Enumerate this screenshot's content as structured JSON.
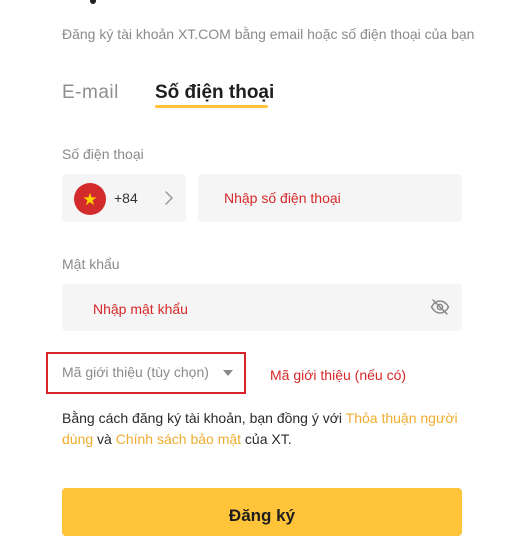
{
  "subtitle": "Đăng ký tài khoản XT.COM bằng email hoặc số điện thoại của bạn",
  "tabs": {
    "email": "E-mail",
    "phone": "Số điện thoại",
    "active": "phone"
  },
  "phone": {
    "label": "Số điện thoại",
    "country_code": "+84",
    "country_flag_icon": "vietnam-flag-icon",
    "placeholder": "Nhập số điện thoại"
  },
  "password": {
    "label": "Mật khẩu",
    "placeholder": "Nhập mật khẩu",
    "toggle_icon": "eye-off-icon"
  },
  "referral": {
    "placeholder": "Mã giới thiệu (tùy chọn)",
    "annotation": "Mã giới thiệu (nếu có)"
  },
  "terms": {
    "prefix": "Bằng cách đăng ký tài khoản, bạn đồng ý với ",
    "user_agreement": "Thỏa thuận người dùng",
    "and": " và ",
    "privacy_policy": "Chính sách bảo mật",
    "suffix": " của XT."
  },
  "submit_label": "Đăng ký",
  "colors": {
    "accent": "#ffc43a",
    "link": "#f0ac2e",
    "annotation_red": "#d62828",
    "highlight_border": "#d8232a",
    "field_bg": "#f5f5f5"
  }
}
